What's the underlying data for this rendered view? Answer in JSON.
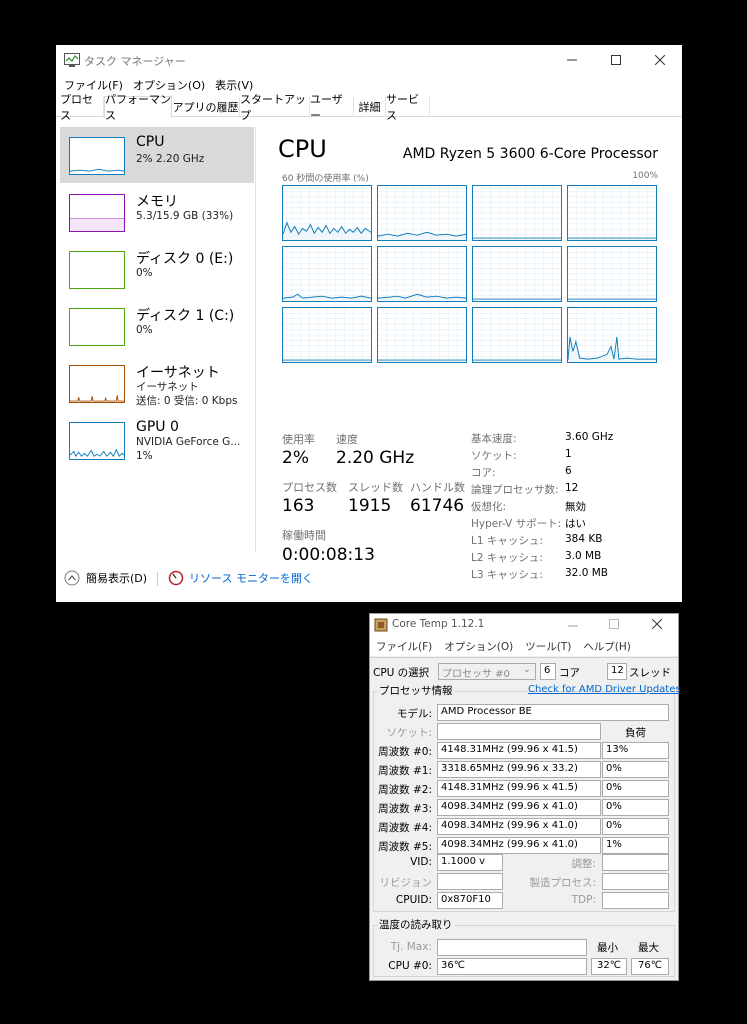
{
  "task_manager": {
    "window_title": "タスク マネージャー",
    "menu": [
      "ファイル(F)",
      "オプション(O)",
      "表示(V)"
    ],
    "tabs": [
      "プロセス",
      "パフォーマンス",
      "アプリの履歴",
      "スタートアップ",
      "ユーザー",
      "詳細",
      "サービス"
    ],
    "active_tab": "パフォーマンス",
    "sidebar": [
      {
        "title": "CPU",
        "sub1": "2%  2.20 GHz",
        "sub2": "",
        "sub3": "",
        "color": "#117dbb"
      },
      {
        "title": "メモリ",
        "sub1": "5.3/15.9 GB (33%)",
        "sub2": "",
        "sub3": "",
        "color": "#8b12ae"
      },
      {
        "title": "ディスク 0 (E:)",
        "sub1": "0%",
        "sub2": "",
        "sub3": "",
        "color": "#4da60c"
      },
      {
        "title": "ディスク 1 (C:)",
        "sub1": "0%",
        "sub2": "",
        "sub3": "",
        "color": "#4da60c"
      },
      {
        "title": "イーサネット",
        "sub1": "イーサネット",
        "sub2": "送信: 0  受信: 0 Kbps",
        "sub3": "",
        "color": "#a74f01"
      },
      {
        "title": "GPU 0",
        "sub1": "NVIDIA GeForce G...",
        "sub2": "1%",
        "sub3": "",
        "color": "#117dbb"
      }
    ],
    "main": {
      "title": "CPU",
      "cpu_name": "AMD Ryzen 5 3600 6-Core Processor",
      "graph_caption": "60 秒間の使用率 (%)",
      "graph_max": "100%",
      "stats": {
        "usage_label": "使用率",
        "usage_value": "2%",
        "speed_label": "速度",
        "speed_value": "2.20 GHz",
        "processes_label": "プロセス数",
        "processes_value": "163",
        "threads_label": "スレッド数",
        "threads_value": "1915",
        "handles_label": "ハンドル数",
        "handles_value": "61746",
        "uptime_label": "稼働時間",
        "uptime_value": "0:00:08:13"
      },
      "specs": [
        {
          "label": "基本速度:",
          "value": "3.60 GHz"
        },
        {
          "label": "ソケット:",
          "value": "1"
        },
        {
          "label": "コア:",
          "value": "6"
        },
        {
          "label": "論理プロセッサ数:",
          "value": "12"
        },
        {
          "label": "仮想化:",
          "value": "無効"
        },
        {
          "label": "Hyper-V サポート:",
          "value": "はい"
        },
        {
          "label": "L1 キャッシュ:",
          "value": "384 KB"
        },
        {
          "label": "L2 キャッシュ:",
          "value": "3.0 MB"
        },
        {
          "label": "L3 キャッシュ:",
          "value": "32.0 MB"
        }
      ]
    },
    "bottom": {
      "fewer_details": "簡易表示(D)",
      "resource_monitor": "リソース モニターを開く"
    }
  },
  "core_temp": {
    "window_title": "Core Temp 1.12.1",
    "menu": [
      "ファイル(F)",
      "オプション(O)",
      "ツール(T)",
      "ヘルプ(H)"
    ],
    "cpu_select_label": "CPU の選択",
    "processor_select": "プロセッサ #0",
    "cores_value": "6",
    "cores_label": "コア",
    "threads_value": "12",
    "threads_label": "スレッド",
    "processor_info_title": "プロセッサ情報",
    "driver_link": "Check for AMD Driver Updates",
    "model_label": "モデル:",
    "model_value": "AMD Processor  BE",
    "socket_label": "ソケット:",
    "load_header": "負荷",
    "frequencies": [
      {
        "label": "周波数 #0:",
        "value": "4148.31MHz (99.96 x 41.5)",
        "load": "13%"
      },
      {
        "label": "周波数 #1:",
        "value": "3318.65MHz (99.96 x 33.2)",
        "load": "0%"
      },
      {
        "label": "周波数 #2:",
        "value": "4148.31MHz (99.96 x 41.5)",
        "load": "0%"
      },
      {
        "label": "周波数 #3:",
        "value": "4098.34MHz (99.96 x 41.0)",
        "load": "0%"
      },
      {
        "label": "周波数 #4:",
        "value": "4098.34MHz (99.96 x 41.0)",
        "load": "0%"
      },
      {
        "label": "周波数 #5:",
        "value": "4098.34MHz (99.96 x 41.0)",
        "load": "1%"
      }
    ],
    "vid_label": "VID:",
    "vid_value": "1.1000 v",
    "adjust_label": "調整:",
    "revision_label": "リビジョン",
    "process_label": "製造プロセス:",
    "cpuid_label": "CPUID:",
    "cpuid_value": "0x870F10",
    "tdp_label": "TDP:",
    "temp_title": "温度の読み取り",
    "tjmax_label": "Tj. Max:",
    "min_label": "最小",
    "max_label": "最大",
    "cpu0_label": "CPU #0:",
    "cpu0_temp": "36℃",
    "cpu0_min": "32℃",
    "cpu0_max": "76℃"
  }
}
